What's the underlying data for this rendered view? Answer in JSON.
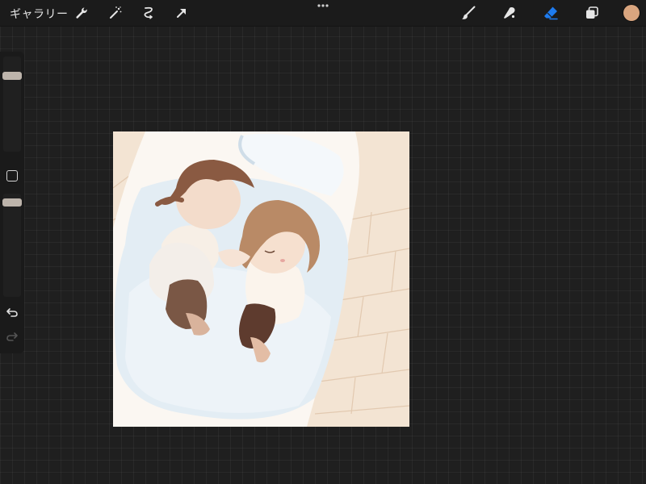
{
  "topbar": {
    "gallery_label": "ギャラリー",
    "left_tools": [
      "wrench-icon",
      "magic-wand-icon",
      "selection-icon",
      "transform-arrow-icon"
    ],
    "right_tools": [
      "brush-icon",
      "smudge-icon",
      "eraser-icon",
      "layers-icon"
    ],
    "active_tool": "eraser-icon"
  },
  "colors": {
    "active_tool": "#1e7cf0",
    "current_color": "#d9a57f"
  },
  "sidebar": {
    "brush_size_level": 0.82,
    "opacity_level": 0.95
  }
}
